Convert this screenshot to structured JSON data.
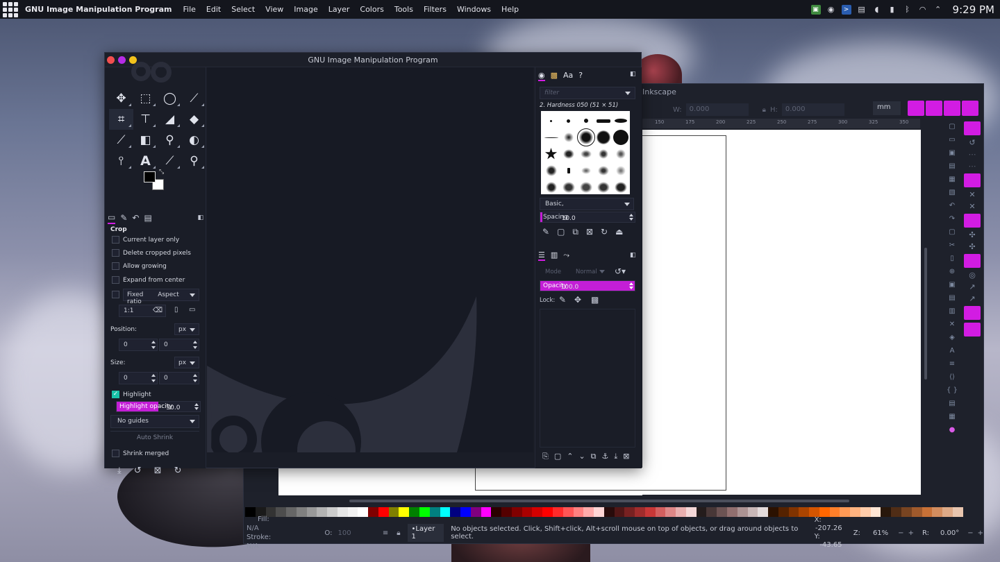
{
  "topbar": {
    "app_name": "GNU Image Manipulation Program",
    "menu": [
      "File",
      "Edit",
      "Select",
      "View",
      "Image",
      "Layer",
      "Colors",
      "Tools",
      "Filters",
      "Windows",
      "Help"
    ],
    "clock": "9:29 PM"
  },
  "inkscape": {
    "title": "Inkscape",
    "toolbar": {
      "w_label": "W:",
      "w_value": "0.000",
      "h_label": "H:",
      "h_value": "0.000",
      "unit": "mm"
    },
    "ruler_ticks": [
      "150",
      "175",
      "200",
      "225",
      "250",
      "275",
      "300",
      "325",
      "350"
    ],
    "status": {
      "fill_label": "Fill:",
      "fill_value": "N/A",
      "stroke_label": "Stroke:",
      "stroke_value": "N/A",
      "opacity_label": "O:",
      "opacity_value": "100",
      "layer": "•Layer 1",
      "message": "No objects selected. Click, Shift+click, Alt+scroll mouse on top of objects, or drag around objects to select.",
      "x_label": "X:",
      "x_value": "-207.26",
      "y_label": "Y:",
      "y_value": "-43.65",
      "zoom_label": "Z:",
      "zoom_value": "61%",
      "rotate_label": "R:",
      "rotate_value": "0.00°"
    },
    "colors": {
      "palette": [
        "#000000",
        "#1a1a1a",
        "#333333",
        "#4d4d4d",
        "#666666",
        "#808080",
        "#999999",
        "#b3b3b3",
        "#cccccc",
        "#e6e6e6",
        "#f2f2f2",
        "#ffffff",
        "#800000",
        "#ff0000",
        "#808000",
        "#ffff00",
        "#008000",
        "#00ff00",
        "#008080",
        "#00ffff",
        "#000080",
        "#0000ff",
        "#800080",
        "#ff00ff",
        "#2b0000",
        "#550000",
        "#800000",
        "#aa0000",
        "#d40000",
        "#ff0000",
        "#ff2a2a",
        "#ff5555",
        "#ff8080",
        "#ffaaaa",
        "#ffd5d5",
        "#280b0b",
        "#501616",
        "#782121",
        "#a02c2c",
        "#c83737",
        "#d35f5f",
        "#de8787",
        "#e9afaf",
        "#f4d7d7",
        "#241c1c",
        "#483737",
        "#6c5353",
        "#916f6f",
        "#ac9393",
        "#c8b7b7",
        "#e3dbdb",
        "#2b1100",
        "#552200",
        "#803300",
        "#aa4400",
        "#d45500",
        "#ff6600",
        "#ff7f2a",
        "#ff9955",
        "#ffb380",
        "#ffccaa",
        "#ffe6d5",
        "#28170b",
        "#502d16",
        "#784421",
        "#a05a2c",
        "#c87137",
        "#d38d5f",
        "#deaa87",
        "#e9c6af"
      ]
    }
  },
  "gimp": {
    "window_title": "GNU Image Manipulation Program",
    "tool_options": {
      "title": "Crop",
      "current_layer_only": "Current layer only",
      "delete_cropped": "Delete cropped pixels",
      "allow_growing": "Allow growing",
      "expand_from_center": "Expand from center",
      "fixed_label": "Fixed",
      "fixed_mode": "Aspect ratio",
      "ratio_value": "1:1",
      "position_label": "Position:",
      "position_unit": "px",
      "pos_x": "0",
      "pos_y": "0",
      "size_label": "Size:",
      "size_unit": "px",
      "size_w": "0",
      "size_h": "0",
      "highlight": "Highlight",
      "highlight_opacity_label": "Highlight opacity",
      "highlight_opacity_value": "50.0",
      "highlight_opacity_level": 0.5,
      "guides": "No guides",
      "auto_shrink": "Auto Shrink",
      "shrink_merged": "Shrink merged"
    },
    "brushes": {
      "filter_placeholder": "filter",
      "selected_brush": "2. Hardness 050 (51 × 51)",
      "tag": "Basic,",
      "spacing_label": "Spacing",
      "spacing_value": "10.0",
      "spacing_level": 0.02
    },
    "layers": {
      "mode_label": "Mode",
      "mode_value": "Normal",
      "opacity_label": "Opacity",
      "opacity_value": "100.0",
      "opacity_level": 1.0,
      "lock_label": "Lock:"
    },
    "accent": "#d21ce3"
  }
}
